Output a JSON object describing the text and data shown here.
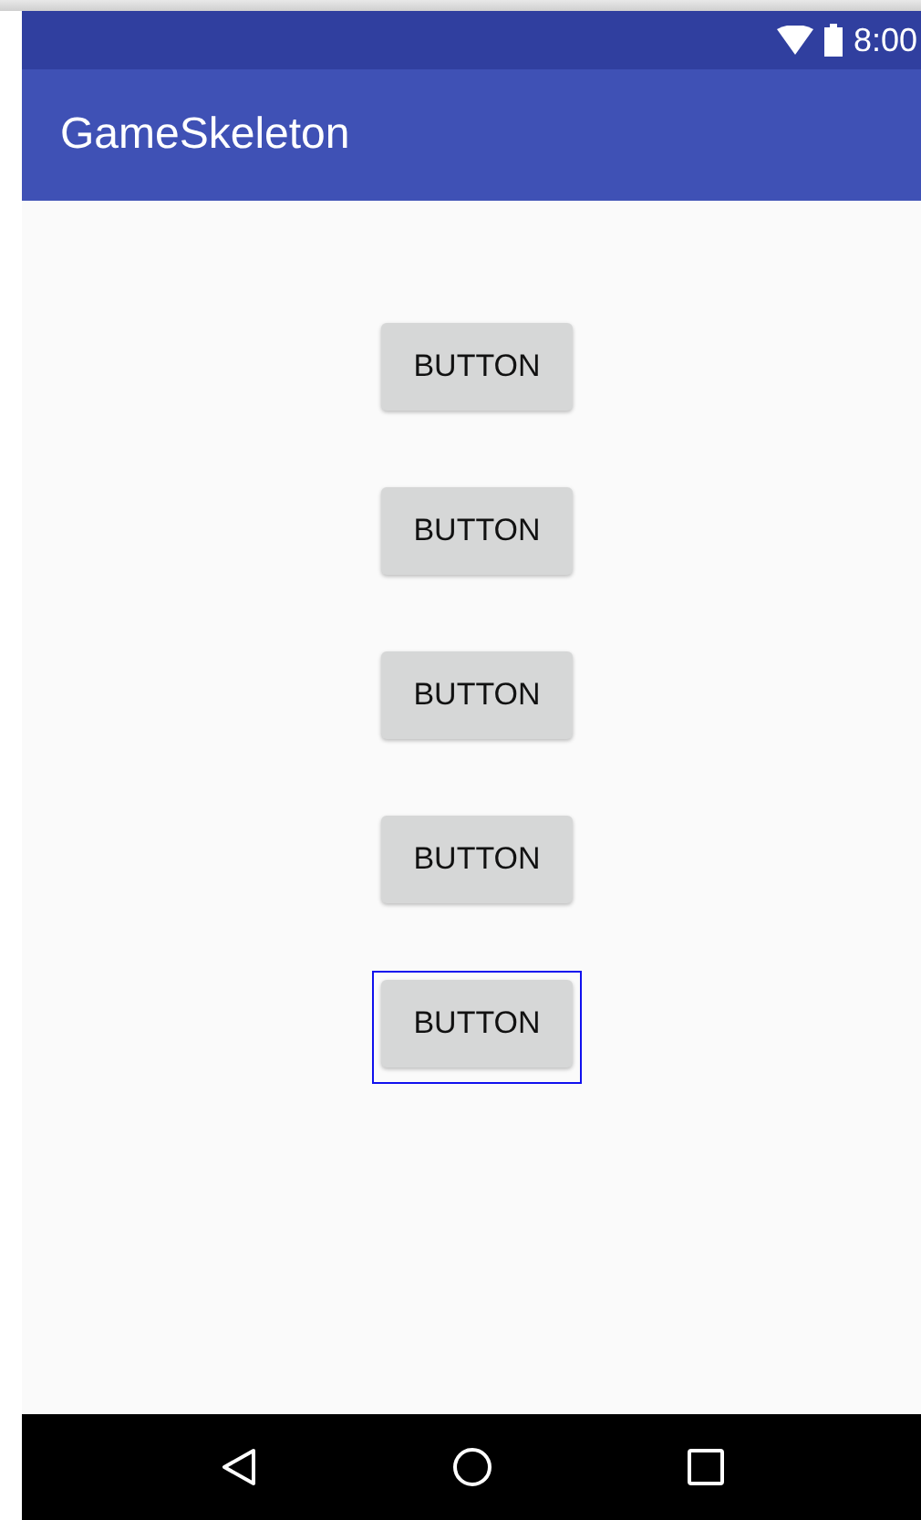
{
  "status_bar": {
    "time": "8:00"
  },
  "app_bar": {
    "title": "GameSkeleton"
  },
  "buttons": [
    {
      "label": "BUTTON",
      "selected": false
    },
    {
      "label": "BUTTON",
      "selected": false
    },
    {
      "label": "BUTTON",
      "selected": false
    },
    {
      "label": "BUTTON",
      "selected": false
    },
    {
      "label": "BUTTON",
      "selected": true
    }
  ]
}
